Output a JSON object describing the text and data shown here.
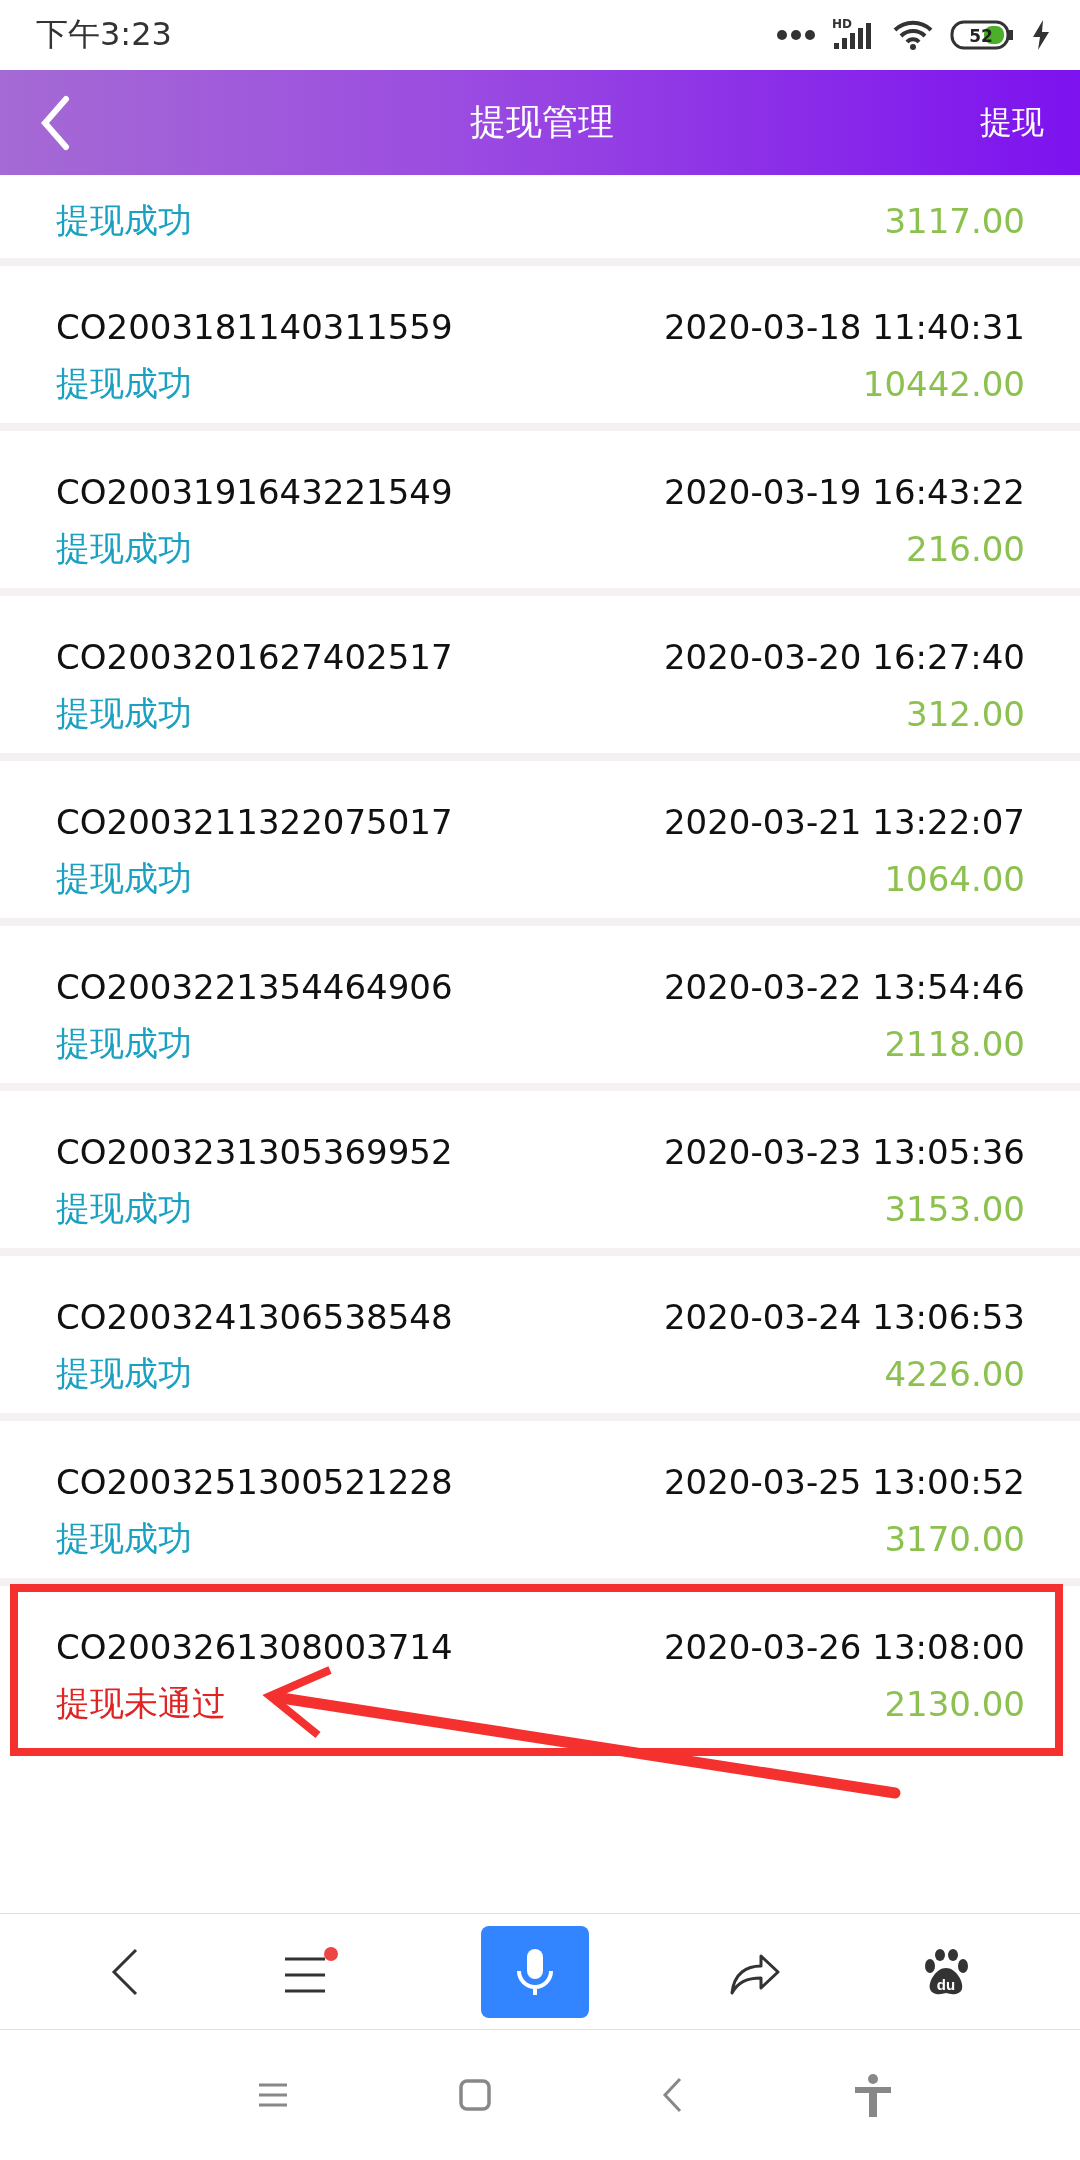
{
  "status_bar": {
    "time": "下午3:23",
    "network_label": "HD",
    "battery": "52"
  },
  "header": {
    "title": "提现管理",
    "action": "提现"
  },
  "records": [
    {
      "status": "提现成功",
      "kind": "success",
      "amount": "3117.00"
    },
    {
      "id": "CO2003181140311559",
      "time": "2020-03-18 11:40:31",
      "status": "提现成功",
      "kind": "success",
      "amount": "10442.00"
    },
    {
      "id": "CO2003191643221549",
      "time": "2020-03-19 16:43:22",
      "status": "提现成功",
      "kind": "success",
      "amount": "216.00"
    },
    {
      "id": "CO2003201627402517",
      "time": "2020-03-20 16:27:40",
      "status": "提现成功",
      "kind": "success",
      "amount": "312.00"
    },
    {
      "id": "CO2003211322075017",
      "time": "2020-03-21 13:22:07",
      "status": "提现成功",
      "kind": "success",
      "amount": "1064.00"
    },
    {
      "id": "CO2003221354464906",
      "time": "2020-03-22 13:54:46",
      "status": "提现成功",
      "kind": "success",
      "amount": "2118.00"
    },
    {
      "id": "CO2003231305369952",
      "time": "2020-03-23 13:05:36",
      "status": "提现成功",
      "kind": "success",
      "amount": "3153.00"
    },
    {
      "id": "CO2003241306538548",
      "time": "2020-03-24 13:06:53",
      "status": "提现成功",
      "kind": "success",
      "amount": "4226.00"
    },
    {
      "id": "CO2003251300521228",
      "time": "2020-03-25 13:00:52",
      "status": "提现成功",
      "kind": "success",
      "amount": "3170.00"
    },
    {
      "id": "CO2003261308003714",
      "time": "2020-03-26 13:08:00",
      "status": "提现未通过",
      "kind": "rejected",
      "amount": "2130.00",
      "highlighted": true
    }
  ],
  "browser_bar": {
    "menu_badge": true,
    "logo_text": "du"
  }
}
